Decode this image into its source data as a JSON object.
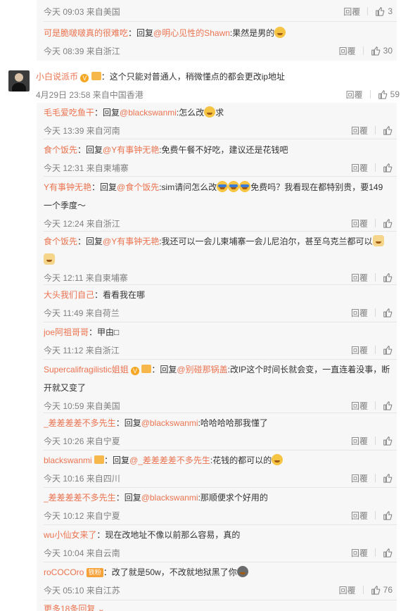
{
  "labels": {
    "reply": "回覆",
    "like_icon": "thumb-up-icon"
  },
  "top_replies": [
    {
      "meta": "今天 09:03 来自美国",
      "likes": "3"
    },
    {
      "user": "可是脆啵啵真的很难吃",
      "reply_word": "：回复",
      "mention": "@明心见性的Shawn",
      "text": ":果然是男的",
      "meta": "今天 08:39 来自浙江",
      "likes": "30"
    }
  ],
  "main_comment": {
    "user": "小白说派币",
    "text": "：这个只能对普通人，稍微懂点的都会更改ip地址",
    "meta": "4月29日 23:58 来自中国香港",
    "likes": "59"
  },
  "replies": [
    {
      "user": "毛毛爱吃鱼干",
      "reply_word": "：回复",
      "mention": "@blackswanmi",
      "text": ":怎么改",
      "tail": "求",
      "meta": "今天 13:39 来自河南"
    },
    {
      "user": "食个饭先",
      "reply_word": "：回复",
      "mention": "@Y有事钟无艳",
      "text": ":免费午餐不好吃，建议还是花钱吧",
      "meta": "今天 12:31 来自柬埔寨"
    },
    {
      "user": "Y有事钟无艳",
      "reply_word": "：回复",
      "mention": "@食个饭先",
      "text": ":sim请问怎么改",
      "tail": "免费吗？我看现在都特别贵，要149",
      "line2": "一个季度～",
      "meta": "今天 12:24 来自浙江"
    },
    {
      "user": "食个饭先",
      "reply_word": "：回复",
      "mention": "@Y有事钟无艳",
      "text": ":我还可以一会儿柬埔寨一会儿尼泊尔，甚至乌克兰都可以",
      "meta": "今天 12:11 来自柬埔寨"
    },
    {
      "user": "大头我们自己",
      "text": "：看看我在哪",
      "meta": "今天 11:49 来自荷兰"
    },
    {
      "user": "joe阿祖哥哥",
      "text": "：甲由□",
      "meta": "今天 11:12 来自浙江"
    },
    {
      "user": "Supercalifragilistic姐姐",
      "reply_word": "：回复",
      "mention": "@别碰那锅盖",
      "text": ":改IP这个时间长就会变，一直连着没事，断",
      "line2": "开就又变了",
      "meta": "今天 10:59 来自美国"
    },
    {
      "user": "_差差差差不多先生",
      "reply_word": "：回复",
      "mention": "@blackswanmi",
      "text": ":哈哈哈哈那我懂了",
      "meta": "今天 10:26 来自宁夏"
    },
    {
      "user": "blackswanmi",
      "reply_word": "：回复",
      "mention": "@_差差差差不多先生",
      "text": ":花钱的都可以的",
      "meta": "今天 10:16 来自四川"
    },
    {
      "user": "_差差差差不多先生",
      "reply_word": "：回复",
      "mention": "@blackswanmi",
      "text": ":那顺便求个好用的",
      "meta": "今天 10:12 来自宁夏"
    },
    {
      "user": "wu小仙女来了",
      "text": "：现在改地址不像以前那么容易，真的",
      "meta": "今天 10:04 来自云南"
    },
    {
      "user": "roCOCOro",
      "badge": "铁粉",
      "text": "：改了就是50w，不改就地狱黑了你",
      "meta": "今天 05:10 来自江苏",
      "likes": "76"
    }
  ],
  "more": "更多18条回复"
}
